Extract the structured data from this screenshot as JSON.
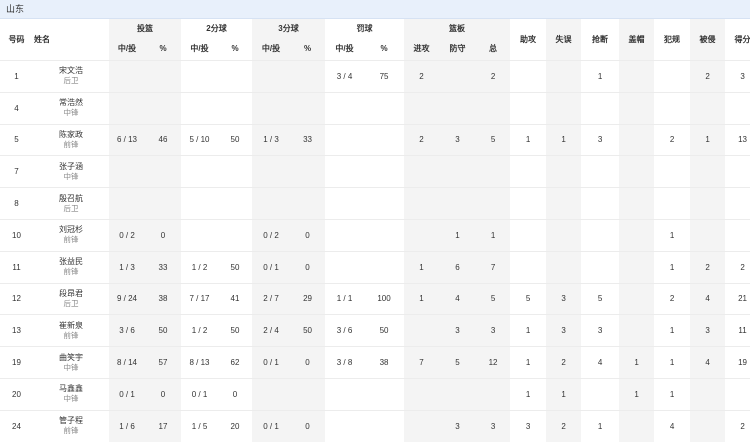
{
  "team": "山东",
  "headers": {
    "number": "号码",
    "name": "姓名",
    "fg": "投篮",
    "two": "2分球",
    "three": "3分球",
    "ft": "罚球",
    "reb": "篮板",
    "made_att": "中/投",
    "pct": "%",
    "off": "进攻",
    "def": "防守",
    "tot": "总",
    "ast": "助攻",
    "tov": "失误",
    "stl": "抢断",
    "blk": "盖帽",
    "pf": "犯规",
    "fd": "被侵",
    "pts": "得分"
  },
  "players": [
    {
      "no": "1",
      "name": "宋文浩",
      "pos": "后卫",
      "fg": "",
      "fg_pct": "",
      "two": "",
      "two_pct": "",
      "three": "",
      "three_pct": "",
      "ft": "3 / 4",
      "ft_pct": "75",
      "oreb": "2",
      "dreb": "",
      "reb": "2",
      "ast": "",
      "tov": "",
      "stl": "1",
      "blk": "",
      "pf": "",
      "fd": "2",
      "pts": "3"
    },
    {
      "no": "4",
      "name": "常浩然",
      "pos": "中锋",
      "fg": "",
      "fg_pct": "",
      "two": "",
      "two_pct": "",
      "three": "",
      "three_pct": "",
      "ft": "",
      "ft_pct": "",
      "oreb": "",
      "dreb": "",
      "reb": "",
      "ast": "",
      "tov": "",
      "stl": "",
      "blk": "",
      "pf": "",
      "fd": "",
      "pts": ""
    },
    {
      "no": "5",
      "name": "陈家政",
      "pos": "前锋",
      "fg": "6 / 13",
      "fg_pct": "46",
      "two": "5 / 10",
      "two_pct": "50",
      "three": "1 / 3",
      "three_pct": "33",
      "ft": "",
      "ft_pct": "",
      "oreb": "2",
      "dreb": "3",
      "reb": "5",
      "ast": "1",
      "tov": "1",
      "stl": "3",
      "blk": "",
      "pf": "2",
      "fd": "1",
      "pts": "13"
    },
    {
      "no": "7",
      "name": "张子涵",
      "pos": "中锋",
      "fg": "",
      "fg_pct": "",
      "two": "",
      "two_pct": "",
      "three": "",
      "three_pct": "",
      "ft": "",
      "ft_pct": "",
      "oreb": "",
      "dreb": "",
      "reb": "",
      "ast": "",
      "tov": "",
      "stl": "",
      "blk": "",
      "pf": "",
      "fd": "",
      "pts": ""
    },
    {
      "no": "8",
      "name": "殷召航",
      "pos": "后卫",
      "fg": "",
      "fg_pct": "",
      "two": "",
      "two_pct": "",
      "three": "",
      "three_pct": "",
      "ft": "",
      "ft_pct": "",
      "oreb": "",
      "dreb": "",
      "reb": "",
      "ast": "",
      "tov": "",
      "stl": "",
      "blk": "",
      "pf": "",
      "fd": "",
      "pts": ""
    },
    {
      "no": "10",
      "name": "刘冠杉",
      "pos": "前锋",
      "fg": "0 / 2",
      "fg_pct": "0",
      "two": "",
      "two_pct": "",
      "three": "0 / 2",
      "three_pct": "0",
      "ft": "",
      "ft_pct": "",
      "oreb": "",
      "dreb": "1",
      "reb": "1",
      "ast": "",
      "tov": "",
      "stl": "",
      "blk": "",
      "pf": "1",
      "fd": "",
      "pts": ""
    },
    {
      "no": "11",
      "name": "张益民",
      "pos": "前锋",
      "fg": "1 / 3",
      "fg_pct": "33",
      "two": "1 / 2",
      "two_pct": "50",
      "three": "0 / 1",
      "three_pct": "0",
      "ft": "",
      "ft_pct": "",
      "oreb": "1",
      "dreb": "6",
      "reb": "7",
      "ast": "",
      "tov": "",
      "stl": "",
      "blk": "",
      "pf": "1",
      "fd": "2",
      "pts": "2"
    },
    {
      "no": "12",
      "name": "段昂君",
      "pos": "后卫",
      "fg": "9 / 24",
      "fg_pct": "38",
      "two": "7 / 17",
      "two_pct": "41",
      "three": "2 / 7",
      "three_pct": "29",
      "ft": "1 / 1",
      "ft_pct": "100",
      "oreb": "1",
      "dreb": "4",
      "reb": "5",
      "ast": "5",
      "tov": "3",
      "stl": "5",
      "blk": "",
      "pf": "2",
      "fd": "4",
      "pts": "21"
    },
    {
      "no": "13",
      "name": "崔新泉",
      "pos": "前锋",
      "fg": "3 / 6",
      "fg_pct": "50",
      "two": "1 / 2",
      "two_pct": "50",
      "three": "2 / 4",
      "three_pct": "50",
      "ft": "3 / 6",
      "ft_pct": "50",
      "oreb": "",
      "dreb": "3",
      "reb": "3",
      "ast": "1",
      "tov": "3",
      "stl": "3",
      "blk": "",
      "pf": "1",
      "fd": "3",
      "pts": "11"
    },
    {
      "no": "19",
      "name": "曲笑宇",
      "pos": "中锋",
      "fg": "8 / 14",
      "fg_pct": "57",
      "two": "8 / 13",
      "two_pct": "62",
      "three": "0 / 1",
      "three_pct": "0",
      "ft": "3 / 8",
      "ft_pct": "38",
      "oreb": "7",
      "dreb": "5",
      "reb": "12",
      "ast": "1",
      "tov": "2",
      "stl": "4",
      "blk": "1",
      "pf": "1",
      "fd": "4",
      "pts": "19"
    },
    {
      "no": "20",
      "name": "马鑫鑫",
      "pos": "中锋",
      "fg": "0 / 1",
      "fg_pct": "0",
      "two": "0 / 1",
      "two_pct": "0",
      "three": "",
      "three_pct": "",
      "ft": "",
      "ft_pct": "",
      "oreb": "",
      "dreb": "",
      "reb": "",
      "ast": "1",
      "tov": "1",
      "stl": "",
      "blk": "1",
      "pf": "1",
      "fd": "",
      "pts": ""
    },
    {
      "no": "24",
      "name": "管子程",
      "pos": "前锋",
      "fg": "1 / 6",
      "fg_pct": "17",
      "two": "1 / 5",
      "two_pct": "20",
      "three": "0 / 1",
      "three_pct": "0",
      "ft": "",
      "ft_pct": "",
      "oreb": "",
      "dreb": "3",
      "reb": "3",
      "ast": "3",
      "tov": "2",
      "stl": "1",
      "blk": "",
      "pf": "4",
      "fd": "",
      "pts": "2"
    }
  ]
}
